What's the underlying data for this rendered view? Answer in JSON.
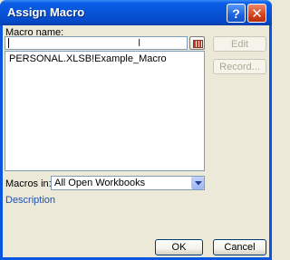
{
  "window": {
    "title": "Assign Macro",
    "help_glyph": "?",
    "close_glyph": "✕"
  },
  "form": {
    "macro_name_label": "Macro name:",
    "macro_name_value": "",
    "macros": [
      "PERSONAL.XLSB!Example_Macro"
    ],
    "macros_in_label": "Macros in:",
    "macros_in_value": "All Open Workbooks",
    "description_label": "Description"
  },
  "buttons": {
    "edit": "Edit",
    "record": "Record...",
    "ok": "OK",
    "cancel": "Cancel"
  },
  "colors": {
    "titlebar": "#0653d6",
    "window_bg": "#ece9d8",
    "description_text": "#1f4fb0"
  },
  "icons": {
    "help": "help-icon",
    "close": "close-icon",
    "picker": "collapse-dialog-icon",
    "dropdown": "chevron-down-icon"
  }
}
